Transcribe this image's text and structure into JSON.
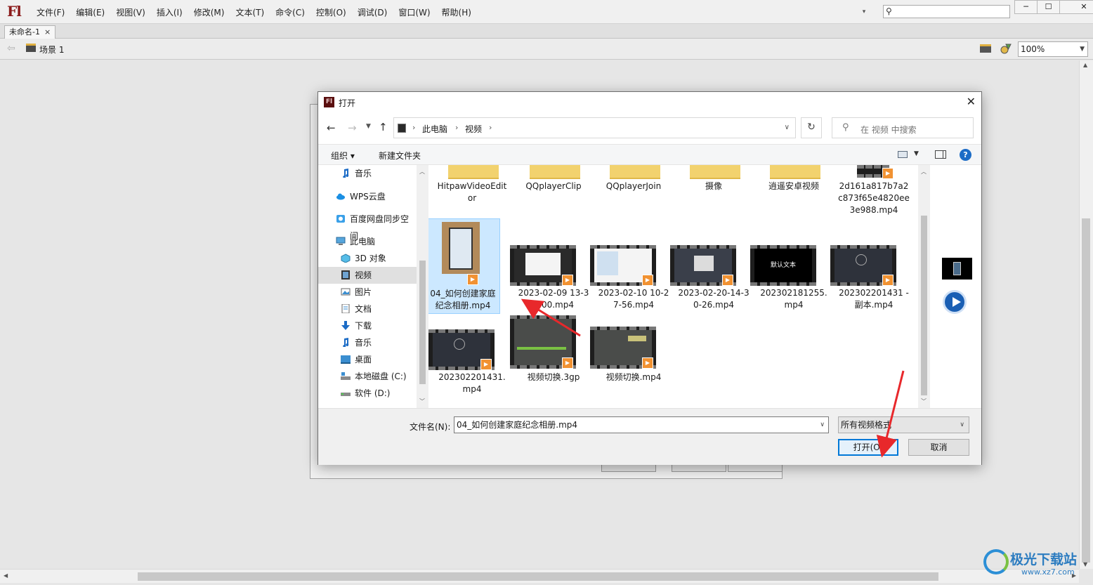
{
  "app": {
    "logo": "Fl",
    "menu": [
      "文件(F)",
      "编辑(E)",
      "视图(V)",
      "插入(I)",
      "修改(M)",
      "文本(T)",
      "命令(C)",
      "控制(O)",
      "调试(D)",
      "窗口(W)",
      "帮助(H)"
    ],
    "doc_tab": "未命名-1",
    "doc_tab_close": "×",
    "scene": "场景 1",
    "zoom": "100%",
    "win_min": "─",
    "win_max": "☐",
    "win_close": "✕"
  },
  "dialog": {
    "title": "打开",
    "close": "✕",
    "breadcrumb": [
      "此电脑",
      "视频"
    ],
    "search_placeholder": "在 视频 中搜索",
    "organize": "组织 ▾",
    "new_folder": "新建文件夹",
    "help": "?",
    "sidebar": [
      {
        "label": "音乐",
        "icon": "music-icon"
      },
      {
        "label": "WPS云盘",
        "icon": "cloud-icon"
      },
      {
        "label": "百度网盘同步空间",
        "icon": "baidu-icon"
      },
      {
        "label": "此电脑",
        "icon": "computer-icon"
      },
      {
        "label": "3D 对象",
        "icon": "cube-icon"
      },
      {
        "label": "视频",
        "icon": "video-folder-icon",
        "selected": true
      },
      {
        "label": "图片",
        "icon": "picture-icon"
      },
      {
        "label": "文档",
        "icon": "document-icon"
      },
      {
        "label": "下载",
        "icon": "download-icon"
      },
      {
        "label": "音乐",
        "icon": "music-icon"
      },
      {
        "label": "桌面",
        "icon": "desktop-icon"
      },
      {
        "label": "本地磁盘 (C:)",
        "icon": "drive-icon"
      },
      {
        "label": "软件 (D:)",
        "icon": "drive-icon"
      }
    ],
    "files": [
      {
        "name": "HitpawVideoEditor",
        "kind": "folder"
      },
      {
        "name": "QQplayerClip",
        "kind": "folder"
      },
      {
        "name": "QQplayerJoin",
        "kind": "folder"
      },
      {
        "name": "摄像",
        "kind": "folder"
      },
      {
        "name": "逍遥安卓视频",
        "kind": "folder"
      },
      {
        "name": "2d161a817b7a2c873f65e4820ee3e988.mp4",
        "kind": "video"
      },
      {
        "name": "04_如何创建家庭纪念相册.mp4",
        "kind": "video",
        "selected": true
      },
      {
        "name": "2023-02-09 13-32-00.mp4",
        "kind": "video"
      },
      {
        "name": "2023-02-10 10-27-56.mp4",
        "kind": "video"
      },
      {
        "name": "2023-02-20-14-30-26.mp4",
        "kind": "video"
      },
      {
        "name": "202302181255.mp4",
        "kind": "video",
        "thumb_text": "默认文本"
      },
      {
        "name": "202302201431 - 副本.mp4",
        "kind": "video"
      },
      {
        "name": "202302201431.mp4",
        "kind": "video"
      },
      {
        "name": "视频切换.3gp",
        "kind": "video"
      },
      {
        "name": "视频切换.mp4",
        "kind": "video"
      }
    ],
    "filename_label": "文件名(N):",
    "filename_value": "04_如何创建家庭纪念相册.mp4",
    "filter": "所有视频格式",
    "open_button": "打开(O)",
    "cancel_button": "取消"
  },
  "watermark": {
    "text": "极光下载站",
    "url": "www.xz7.com"
  },
  "colors": {
    "accent": "#0078d7",
    "selection": "#cce8ff",
    "annotation_arrow": "#e8282b",
    "flash_logo": "#8b1a1a"
  }
}
